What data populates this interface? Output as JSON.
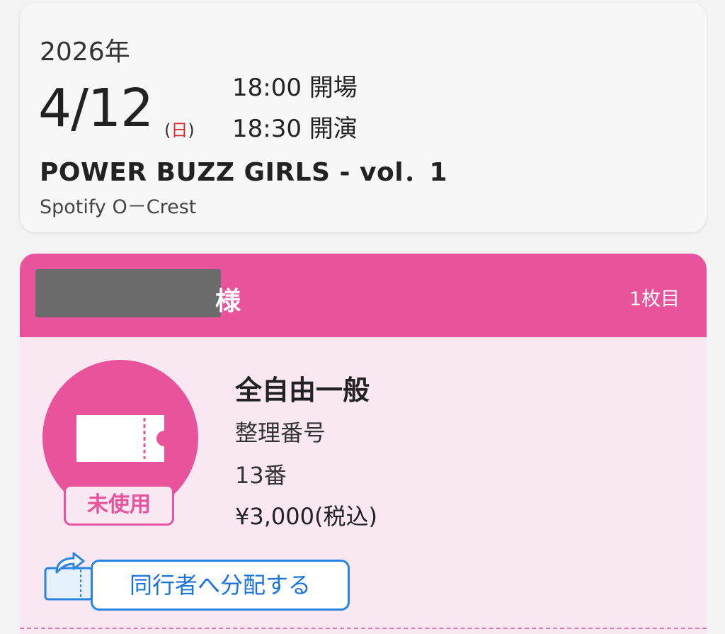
{
  "event": {
    "year": "2026年",
    "date": "4/12",
    "weekday_open": "(",
    "weekday_char": "日",
    "weekday_close": ")",
    "doors_time": "18:00 開場",
    "show_time": "18:30 開演",
    "title": "POWER BUZZ GIRLS - vol．1",
    "venue": "Spotify O－Crest"
  },
  "ticket": {
    "holder_suffix": "様",
    "count_label": "1枚目",
    "status": "未使用",
    "seat_type": "全自由一般",
    "number_label": "整理番号",
    "number_value": "13番",
    "price": "¥3,000(税込)",
    "share_label": "同行者へ分配する"
  },
  "colors": {
    "accent_pink": "#e8539c",
    "ticket_bg": "#f9e8f2",
    "share_blue": "#2a84e6",
    "weekday_red": "#e02a2a"
  },
  "icons": [
    "ticket-icon",
    "share-ticket-icon"
  ]
}
